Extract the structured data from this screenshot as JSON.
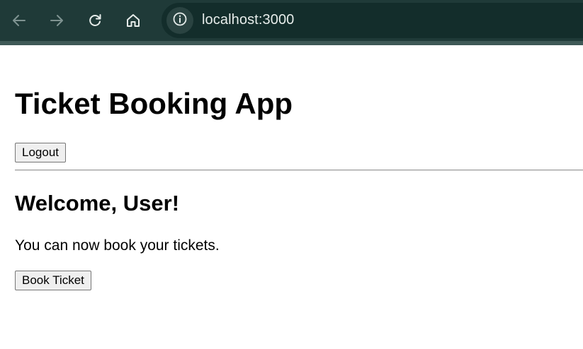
{
  "browser": {
    "url": "localhost:3000",
    "icons": {
      "back": "arrow-left-icon",
      "forward": "arrow-right-icon",
      "reload": "reload-icon",
      "home": "home-icon",
      "site_info": "info-icon"
    },
    "colors": {
      "toolbar": "#1f3a38",
      "omnibox": "#132d2b",
      "url_text": "#e6ecea"
    }
  },
  "app": {
    "title": "Ticket Booking App",
    "logout_label": "Logout",
    "welcome_heading": "Welcome, User!",
    "message": "You can now book your tickets.",
    "book_ticket_label": "Book Ticket"
  }
}
